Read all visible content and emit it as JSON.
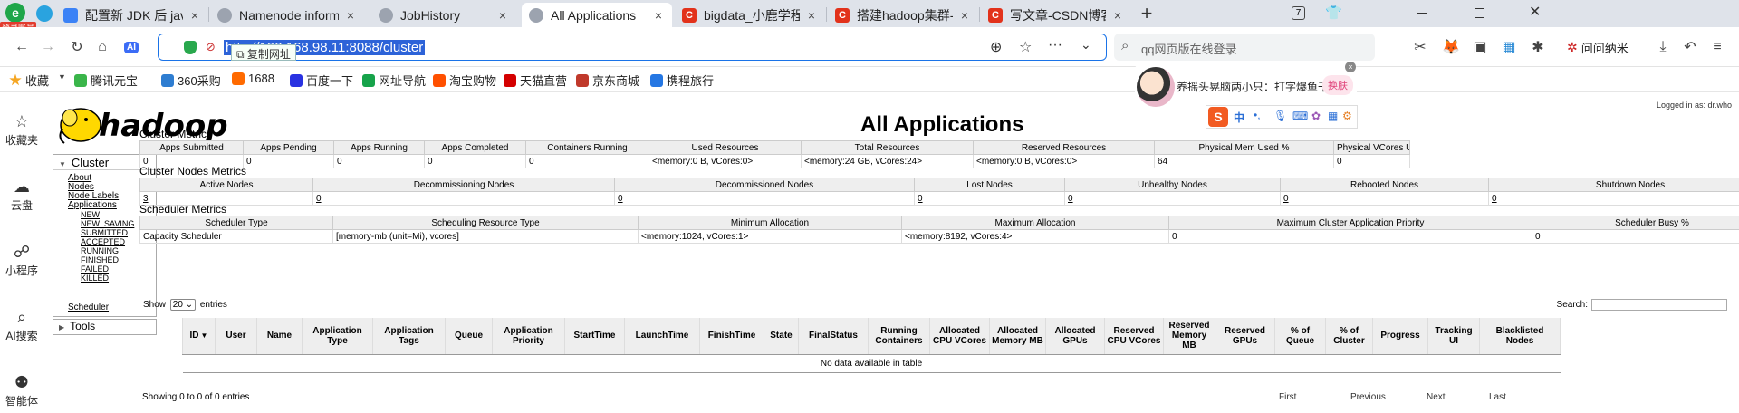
{
  "browser": {
    "profile_badge": "登录账号",
    "tabs": [
      {
        "title": "配置新 JDK 后 java -versio",
        "icon": "doc-icon",
        "color": "#3b82f6",
        "active": false
      },
      {
        "title": "Namenode information",
        "icon": "globe-icon",
        "color": "#9ca3af",
        "active": false
      },
      {
        "title": "JobHistory",
        "icon": "globe-icon",
        "color": "#9ca3af",
        "active": false
      },
      {
        "title": "All Applications",
        "icon": "globe-icon",
        "color": "#9ca3af",
        "active": true
      },
      {
        "title": "bigdata_小鹿学程序的博客",
        "icon": "csdn-icon",
        "color": "#e2321b",
        "active": false
      },
      {
        "title": "搭建hadoop集群-CSDN博客",
        "icon": "csdn-icon",
        "color": "#e2321b",
        "active": false
      },
      {
        "title": "写文章-CSDN博客",
        "icon": "csdn-icon",
        "color": "#e2321b",
        "active": false
      }
    ],
    "new_tab": "+",
    "url": "http://192.168.98.11:8088/cluster",
    "copy_tip": "复制网址",
    "search_placeholder": "qq网页版在线登录",
    "ai_badge": "AI",
    "user_button": "问问纳米",
    "bookmarks": [
      {
        "label": "收藏",
        "icon": "star-icon",
        "color": "#f5a623"
      },
      {
        "label": "腾讯元宝",
        "icon": "yuanbao-icon",
        "color": "#3ab54a"
      },
      {
        "label": "360采购",
        "icon": "360-icon",
        "color": "#2e7dd1"
      },
      {
        "label": "1688",
        "icon": "1688-icon",
        "color": "#ff6a00"
      },
      {
        "label": "百度一下",
        "icon": "baidu-icon",
        "color": "#2932e1"
      },
      {
        "label": "网址导航",
        "icon": "hao-icon",
        "color": "#16a34a"
      },
      {
        "label": "淘宝购物",
        "icon": "taobao-icon",
        "color": "#ff5000"
      },
      {
        "label": "天猫直营",
        "icon": "tmall-icon",
        "color": "#d40000"
      },
      {
        "label": "京东商城",
        "icon": "jd-icon",
        "color": "#c0392b"
      },
      {
        "label": "携程旅行",
        "icon": "ctrip-icon",
        "color": "#2577e3"
      }
    ],
    "sidebar": [
      {
        "label": "收藏夹",
        "icon": "star-outline-icon"
      },
      {
        "label": "云盘",
        "icon": "cloud-icon"
      },
      {
        "label": "小程序",
        "icon": "miniprogram-icon"
      },
      {
        "label": "AI搜索",
        "icon": "search-icon"
      },
      {
        "label": "智能体",
        "icon": "robot-icon"
      }
    ]
  },
  "overlay": {
    "card_text": "养摇头晃脑两小只：打字爆鱼干",
    "card_button": "换肤"
  },
  "page": {
    "title": "All Applications",
    "logged_in": "Logged in as: dr.who",
    "logo_text": "hadoop",
    "nav": {
      "cluster_header": "Cluster",
      "links": [
        "About",
        "Nodes",
        "Node Labels",
        "Applications"
      ],
      "app_states": [
        "NEW",
        "NEW_SAVING",
        "SUBMITTED",
        "ACCEPTED",
        "RUNNING",
        "FINISHED",
        "FAILED",
        "KILLED"
      ],
      "scheduler": "Scheduler",
      "tools_header": "Tools"
    },
    "cluster_metrics": {
      "title": "Cluster Metrics",
      "headers": [
        "Apps Submitted",
        "Apps Pending",
        "Apps Running",
        "Apps Completed",
        "Containers Running",
        "Used Resources",
        "Total Resources",
        "Reserved Resources",
        "Physical Mem Used %",
        "Physical VCores Used %"
      ],
      "values": [
        "0",
        "0",
        "0",
        "0",
        "0",
        "<memory:0 B, vCores:0>",
        "<memory:24 GB, vCores:24>",
        "<memory:0 B, vCores:0>",
        "64",
        "0"
      ]
    },
    "node_metrics": {
      "title": "Cluster Nodes Metrics",
      "headers": [
        "Active Nodes",
        "Decommissioning Nodes",
        "Decommissioned Nodes",
        "Lost Nodes",
        "Unhealthy Nodes",
        "Rebooted Nodes",
        "Shutdown Nodes"
      ],
      "values": [
        "3",
        "0",
        "0",
        "0",
        "0",
        "0",
        "0"
      ]
    },
    "scheduler_metrics": {
      "title": "Scheduler Metrics",
      "headers": [
        "Scheduler Type",
        "Scheduling Resource Type",
        "Minimum Allocation",
        "Maximum Allocation",
        "Maximum Cluster Application Priority",
        "Scheduler Busy %"
      ],
      "values": [
        "Capacity Scheduler",
        "[memory-mb (unit=Mi), vcores]",
        "<memory:1024, vCores:1>",
        "<memory:8192, vCores:4>",
        "0",
        "0"
      ]
    },
    "apps_table": {
      "show_label": "Show",
      "page_size": "20",
      "entries_label": "entries",
      "search_label": "Search:",
      "columns": [
        "ID",
        "User",
        "Name",
        "Application Type",
        "Application Tags",
        "Queue",
        "Application Priority",
        "StartTime",
        "LaunchTime",
        "FinishTime",
        "State",
        "FinalStatus",
        "Running Containers",
        "Allocated CPU VCores",
        "Allocated Memory MB",
        "Allocated GPUs",
        "Reserved CPU VCores",
        "Reserved Memory MB",
        "Reserved GPUs",
        "% of Queue",
        "% of Cluster",
        "Progress",
        "Tracking UI",
        "Blacklisted Nodes"
      ],
      "empty_message": "No data available in table",
      "info": "Showing 0 to 0 of 0 entries",
      "pager": [
        "First",
        "Previous",
        "Next",
        "Last"
      ]
    }
  }
}
